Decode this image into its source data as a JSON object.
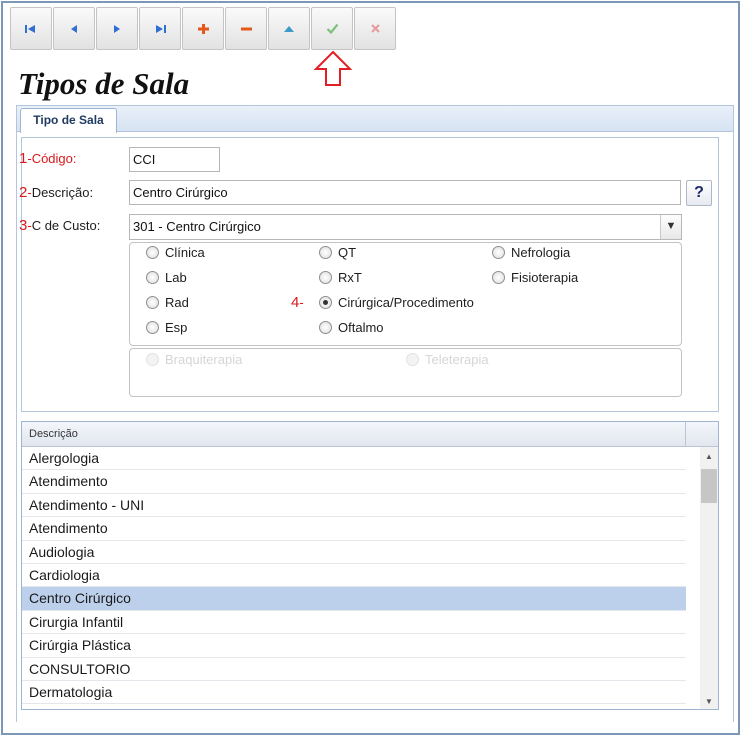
{
  "toolbar": {
    "buttons": [
      {
        "name": "first-record-button",
        "icon": "first-icon",
        "color": "#2f6fd1"
      },
      {
        "name": "previous-record-button",
        "icon": "previous-icon",
        "color": "#2f6fd1"
      },
      {
        "name": "next-record-button",
        "icon": "next-icon",
        "color": "#2f6fd1"
      },
      {
        "name": "last-record-button",
        "icon": "last-icon",
        "color": "#2f6fd1"
      },
      {
        "name": "insert-button",
        "icon": "plus-icon",
        "color": "#e5581c"
      },
      {
        "name": "delete-button",
        "icon": "minus-icon",
        "color": "#e5581c"
      },
      {
        "name": "edit-button",
        "icon": "up-triangle-icon",
        "color": "#3b9ac6"
      },
      {
        "name": "confirm-button",
        "icon": "check-icon",
        "color": "#7fbf7f"
      },
      {
        "name": "cancel-button",
        "icon": "x-icon",
        "color": "#e79b9b"
      }
    ],
    "annotation_arrow_color": "#e31e24"
  },
  "page": {
    "title": "Tipos de Sala"
  },
  "tab": {
    "label": "Tipo de Sala"
  },
  "form": {
    "codigo": {
      "num": "1",
      "sep": "-",
      "label": "Código:",
      "value": "CCI"
    },
    "descricao": {
      "num": "2",
      "sep": "-",
      "label": "Descrição:",
      "value": "Centro Cirúrgico"
    },
    "custo": {
      "num": "3",
      "sep": "-",
      "label": "C de Custo:",
      "value": "301 - Centro Cirúrgico"
    },
    "help_label": "?",
    "radio_marker": {
      "num": "4",
      "sep": "-"
    },
    "radios": [
      {
        "label": "Clínica",
        "checked": false
      },
      {
        "label": "QT",
        "checked": false
      },
      {
        "label": "Nefrologia",
        "checked": false
      },
      {
        "label": "Lab",
        "checked": false
      },
      {
        "label": "RxT",
        "checked": false
      },
      {
        "label": "Fisioterapia",
        "checked": false
      },
      {
        "label": "Rad",
        "checked": false
      },
      {
        "label": "Cirúrgica/Procedimento",
        "checked": true
      },
      {
        "label": "Esp",
        "checked": false
      },
      {
        "label": "Oftalmo",
        "checked": false
      }
    ],
    "radios_disabled": [
      {
        "label": "Braquiterapia"
      },
      {
        "label": "Teleterapia"
      }
    ]
  },
  "grid": {
    "header": "Descrição",
    "rows": [
      "Alergologia",
      "Atendimento",
      "Atendimento - UNI",
      "Atendimento",
      "Audiologia",
      "Cardiologia",
      "Centro Cirúrgico",
      "Cirurgia Infantil",
      "Cirúrgia Plástica",
      "CONSULTORIO",
      "Dermatologia"
    ],
    "selected_index": 6
  }
}
